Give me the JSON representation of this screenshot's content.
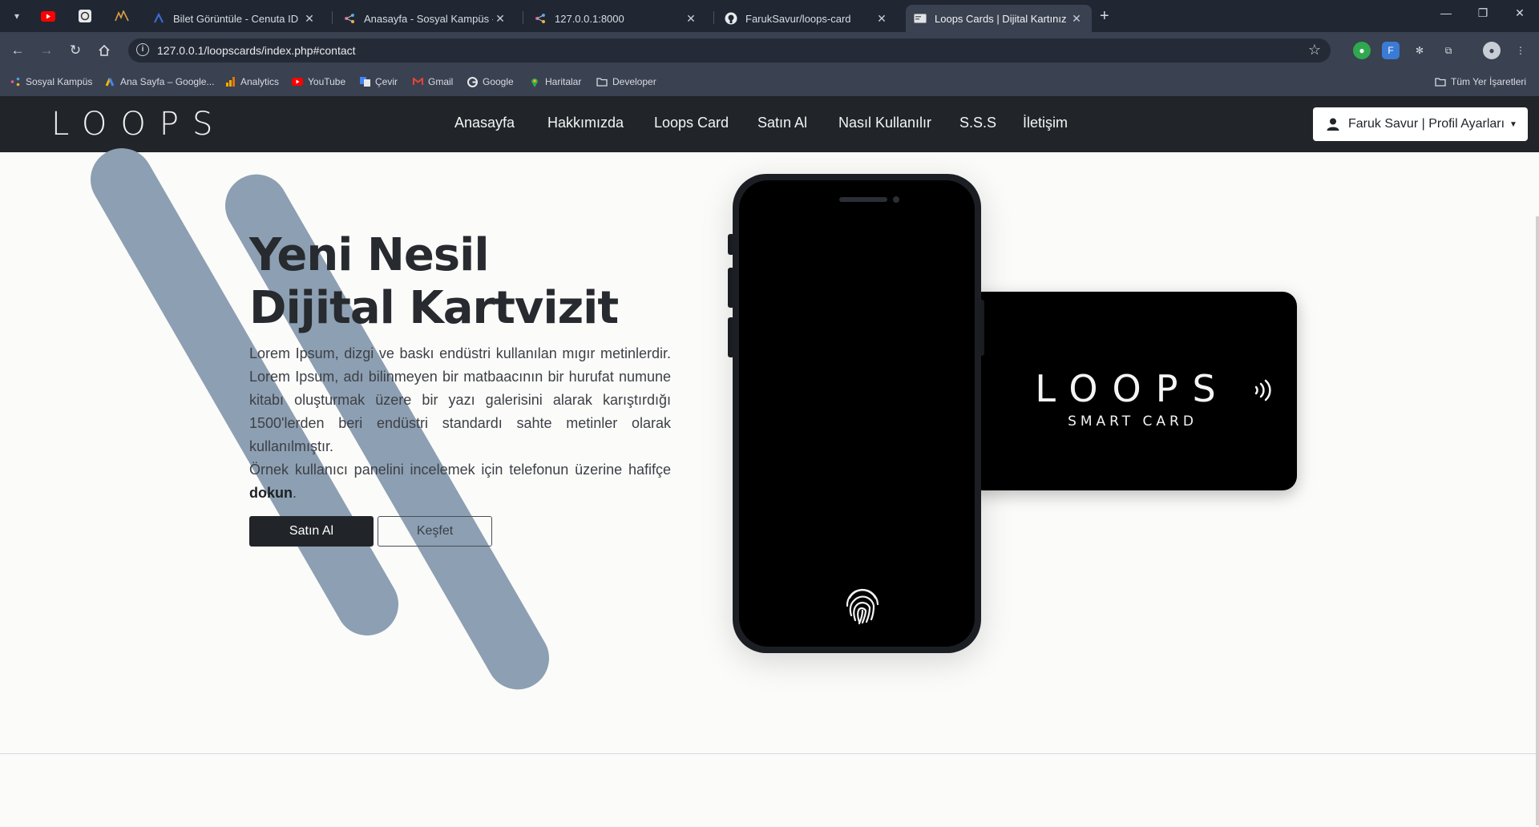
{
  "browser": {
    "tabs": [
      {
        "title": "Bilet Görüntüle - Cenuta ID",
        "active": false
      },
      {
        "title": "Anasayfa - Sosyal Kampüs - Şeh",
        "active": false
      },
      {
        "title": "127.0.0.1:8000",
        "active": false
      },
      {
        "title": "FarukSavur/loops-card",
        "active": false
      },
      {
        "title": "Loops Cards | Dijital Kartınız",
        "active": true
      }
    ],
    "url": "127.0.0.1/loopscards/index.php#contact",
    "bookmarks": [
      "Sosyal Kampüs",
      "Ana Sayfa – Google...",
      "Analytics",
      "YouTube",
      "Çevir",
      "Gmail",
      "Google",
      "Haritalar",
      "Developer"
    ],
    "all_bookmarks": "Tüm Yer İşaretleri"
  },
  "site": {
    "logo": "LOOPS",
    "menu": [
      "Anasayfa",
      "Hakkımızda",
      "Loops Card",
      "Satın Al",
      "Nasıl Kullanılır",
      "S.S.S",
      "İletişim"
    ],
    "profile": "Faruk Savur | Profil Ayarları",
    "hero": {
      "title_line1": "Yeni Nesil",
      "title_line2": "Dijital Kartvizit",
      "paragraph1": "Lorem Ipsum, dizgi ve baskı endüstri kullanılan mıgır metinlerdir. Lorem Ipsum, adı bilinmeyen bir matbaacının bir hurufat numune kitabı oluşturmak üzere bir yazı galerisini alarak karıştırdığı 1500'lerden beri endüstri standardı sahte metinler olarak kullanılmıştır.",
      "paragraph2_prefix": "Örnek kullanıcı panelini incelemek için telefonun üzerine hafifçe",
      "paragraph2_bold": "dokun",
      "paragraph2_suffix": ".",
      "buy_button": "Satın Al",
      "explore_button": "Keşfet"
    },
    "card": {
      "logo": "LOOPS",
      "subtitle": "SMART CARD"
    }
  }
}
